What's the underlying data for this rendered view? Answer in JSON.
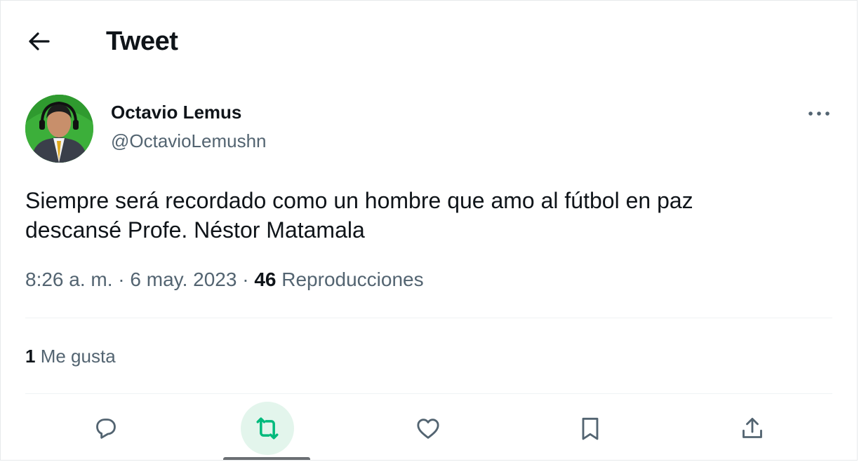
{
  "header": {
    "title": "Tweet",
    "back_icon": "arrow-left-icon"
  },
  "author": {
    "name": "Octavio Lemus",
    "handle": "@OctavioLemushn",
    "avatar_bg": "#39a83a"
  },
  "tweet": {
    "text_line1": "Siempre será recordado como un hombre que amo al fútbol en paz",
    "text_line2": "descansé Profe. Néstor Matamala",
    "time": "8:26 a. m.",
    "separator": "·",
    "date": "6 may. 2023",
    "views_count": "46",
    "views_label": "Reproducciones"
  },
  "engagement": {
    "likes_count": "1",
    "likes_label": "Me gusta"
  },
  "actions": [
    {
      "name": "reply",
      "icon": "reply-icon"
    },
    {
      "name": "retweet",
      "icon": "retweet-icon",
      "color": "#00ba7c"
    },
    {
      "name": "like",
      "icon": "heart-icon"
    },
    {
      "name": "bookmark",
      "icon": "bookmark-icon"
    },
    {
      "name": "share",
      "icon": "share-icon"
    }
  ],
  "colors": {
    "text": "#0f1419",
    "secondary": "#536471",
    "retweet_green": "#00ba7c",
    "retweet_bg": "#e3f5ec"
  }
}
